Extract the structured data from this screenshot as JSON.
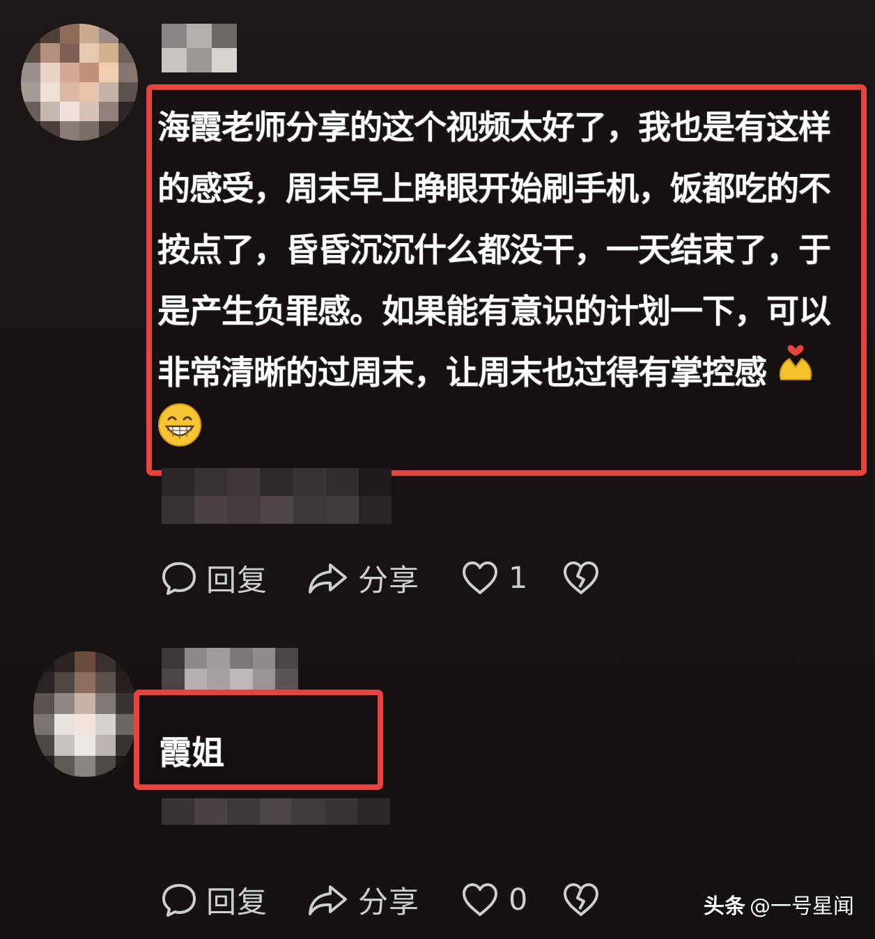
{
  "comments": [
    {
      "text": "海霞老师分享的这个视频太好了，我也是有这样的感受，周末早上睁眼开始刷手机，饭都吃的不按点了，昏昏沉沉什么都没干，一天结束了，于是产生负罪感。如果能有意识的计划一下，可以非常清晰的过周末，让周末也过得有掌控感",
      "emojis": [
        "heart-hands-emoji",
        "grinning-emoji"
      ],
      "actions": {
        "reply": "回复",
        "share": "分享",
        "likes": "1"
      }
    },
    {
      "text": "霞姐",
      "actions": {
        "reply": "回复",
        "share": "分享",
        "likes": "0"
      }
    }
  ],
  "icons": {
    "reply": "chat-bubble-icon",
    "share": "share-arrow-icon",
    "like": "heart-outline-icon",
    "dislike": "broken-heart-icon"
  },
  "colors": {
    "background": "#1a1414",
    "highlight": "#e8443f",
    "text": "#ffffff",
    "action_text": "#cfcfcf"
  },
  "watermark": {
    "brand": "头条",
    "account": "@一号星闻"
  }
}
